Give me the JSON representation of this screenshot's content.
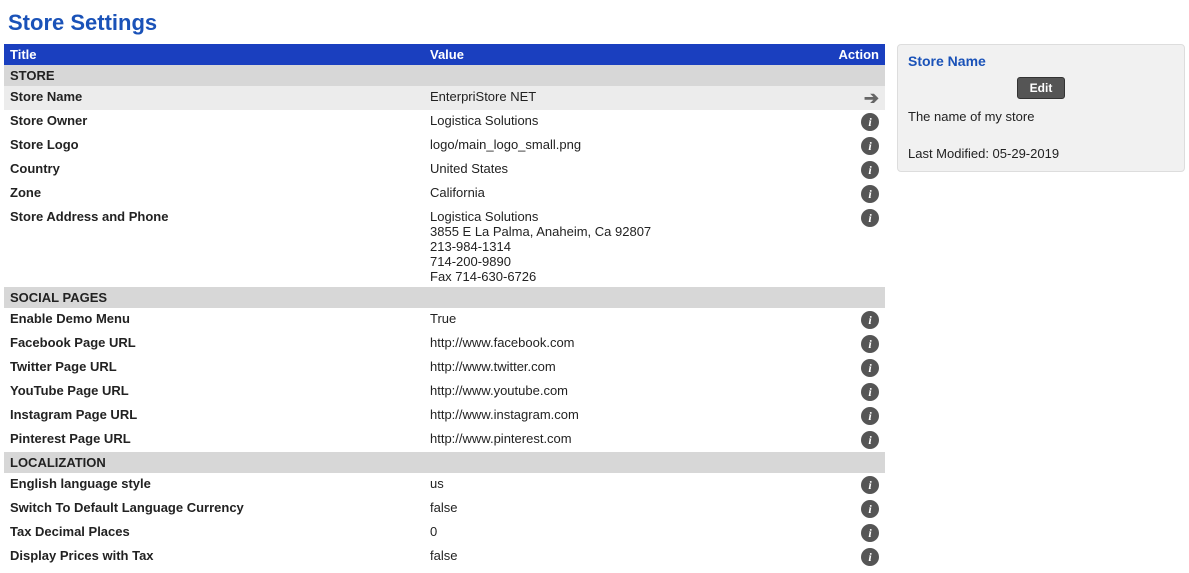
{
  "page_title": "Store Settings",
  "columns": {
    "title": "Title",
    "value": "Value",
    "action": "Action"
  },
  "sections": [
    {
      "name": "STORE",
      "rows": [
        {
          "title": "Store Name",
          "value": "EnterpriStore NET",
          "selected": true,
          "icon": "arrow"
        },
        {
          "title": "Store Owner",
          "value": "Logistica Solutions",
          "icon": "info"
        },
        {
          "title": "Store Logo",
          "value": "logo/main_logo_small.png",
          "icon": "info"
        },
        {
          "title": "Country",
          "value": "United States",
          "icon": "info"
        },
        {
          "title": "Zone",
          "value": "California",
          "icon": "info"
        },
        {
          "title": "Store Address and Phone",
          "value": "Logistica Solutions\n3855 E La Palma, Anaheim, Ca 92807\n213-984-1314\n714-200-9890\nFax 714-630-6726",
          "icon": "info"
        }
      ]
    },
    {
      "name": "SOCIAL PAGES",
      "rows": [
        {
          "title": "Enable Demo Menu",
          "value": "True",
          "icon": "info"
        },
        {
          "title": "Facebook Page URL",
          "value": "http://www.facebook.com",
          "icon": "info"
        },
        {
          "title": "Twitter Page URL",
          "value": "http://www.twitter.com",
          "icon": "info"
        },
        {
          "title": "YouTube Page URL",
          "value": "http://www.youtube.com",
          "icon": "info"
        },
        {
          "title": "Instagram Page URL",
          "value": "http://www.instagram.com",
          "icon": "info"
        },
        {
          "title": "Pinterest Page URL",
          "value": "http://www.pinterest.com",
          "icon": "info"
        }
      ]
    },
    {
      "name": "LOCALIZATION",
      "rows": [
        {
          "title": "English language style",
          "value": "us",
          "icon": "info"
        },
        {
          "title": "Switch To Default Language Currency",
          "value": "false",
          "icon": "info"
        },
        {
          "title": "Tax Decimal Places",
          "value": "0",
          "icon": "info"
        },
        {
          "title": "Display Prices with Tax",
          "value": "false",
          "icon": "info"
        }
      ]
    }
  ],
  "side": {
    "title": "Store Name",
    "edit_label": "Edit",
    "description": "The name of my store",
    "modified_prefix": "Last Modified: ",
    "modified_date": "05-29-2019"
  }
}
